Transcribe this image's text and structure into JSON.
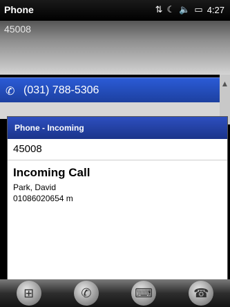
{
  "statusbar": {
    "title": "Phone",
    "time": "4:27",
    "icons": [
      "signal-arrows-icon",
      "connection-icon",
      "volume-icon",
      "battery-icon"
    ]
  },
  "header": {
    "dialed": "45008"
  },
  "match": {
    "number": "(031) 788-5306"
  },
  "dialog": {
    "title": "Phone - Incoming",
    "number": "45008",
    "heading": "Incoming Call",
    "caller_name": "Park, David",
    "caller_number": "01086020654 m"
  },
  "taskbar": {
    "buttons": [
      "windows-start-icon",
      "phone-icon",
      "keyboard-icon",
      "hangup-icon"
    ]
  }
}
